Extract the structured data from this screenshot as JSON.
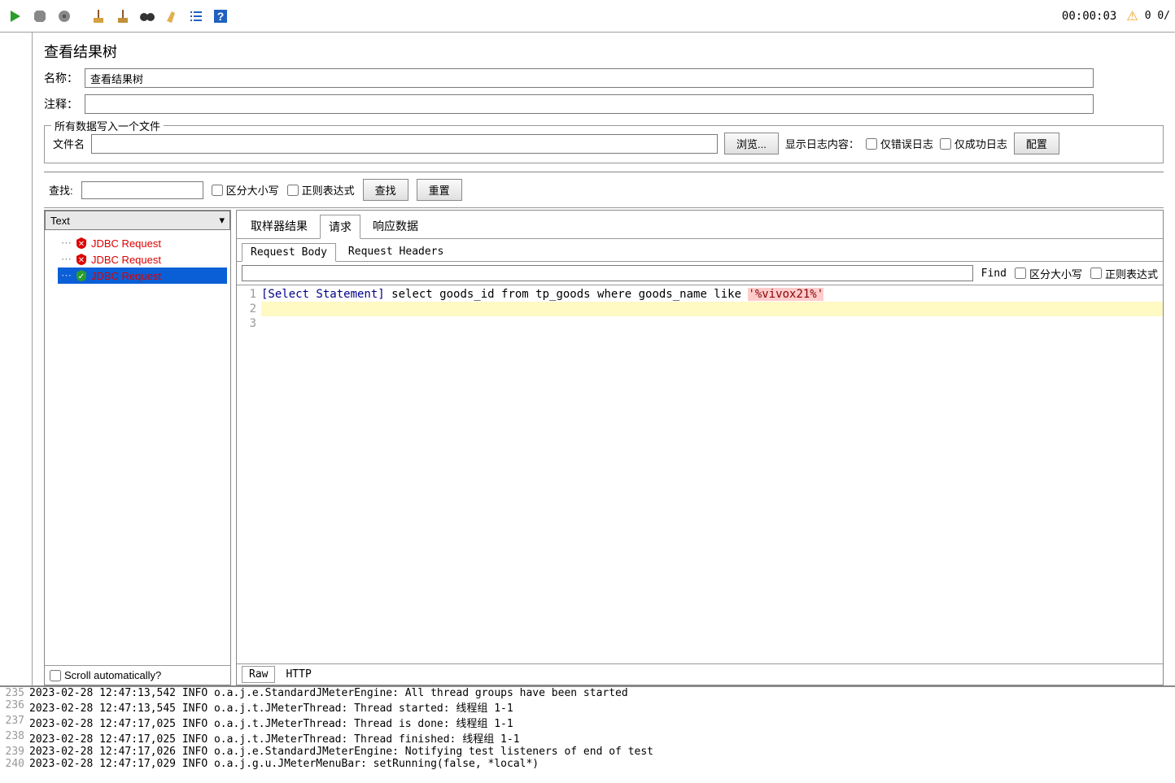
{
  "toolbar": {
    "timer": "00:00:03",
    "count": "0  0/"
  },
  "panel": {
    "title": "查看结果树",
    "name_label": "名称：",
    "name_value": "查看结果树",
    "comment_label": "注释：",
    "comment_value": ""
  },
  "file_section": {
    "legend": "所有数据写入一个文件",
    "filename_label": "文件名",
    "filename_value": "",
    "browse": "浏览...",
    "show_log_label": "显示日志内容：",
    "only_error": "仅错误日志",
    "only_success": "仅成功日志",
    "configure": "配置"
  },
  "search": {
    "label": "查找:",
    "value": "",
    "case_sensitive": "区分大小写",
    "regex": "正则表达式",
    "find_btn": "查找",
    "reset_btn": "重置"
  },
  "tree": {
    "combo_value": "Text",
    "items": [
      {
        "status": "fail",
        "label": "JDBC Request"
      },
      {
        "status": "fail",
        "label": "JDBC Request"
      },
      {
        "status": "ok",
        "label": "JDBC Request"
      }
    ],
    "scroll_auto": "Scroll automatically?"
  },
  "detail": {
    "tabs": [
      "取样器结果",
      "请求",
      "响应数据"
    ],
    "active_tab": 1,
    "subtabs": [
      "Request Body",
      "Request Headers"
    ],
    "active_subtab": 0,
    "find_label": "Find",
    "find_case": "区分大小写",
    "find_regex": "正则表达式",
    "code": {
      "line1_prefix": "[Select Statement] ",
      "line1_sql": "select goods_id from tp_goods where goods_name like ",
      "line1_str": "'%vivox21%'"
    },
    "bottom_tabs": [
      "Raw",
      "HTTP"
    ]
  },
  "log": [
    {
      "n": 235,
      "t": "2023-02-28 12:47:13,542 INFO o.a.j.e.StandardJMeterEngine: All thread groups have been started"
    },
    {
      "n": 236,
      "t": "2023-02-28 12:47:13,545 INFO o.a.j.t.JMeterThread: Thread started: 线程组 1-1"
    },
    {
      "n": 237,
      "t": "2023-02-28 12:47:17,025 INFO o.a.j.t.JMeterThread: Thread is done: 线程组 1-1"
    },
    {
      "n": 238,
      "t": "2023-02-28 12:47:17,025 INFO o.a.j.t.JMeterThread: Thread finished: 线程组 1-1"
    },
    {
      "n": 239,
      "t": "2023-02-28 12:47:17,026 INFO o.a.j.e.StandardJMeterEngine: Notifying test listeners of end of test"
    },
    {
      "n": 240,
      "t": "2023-02-28 12:47:17,029 INFO o.a.j.g.u.JMeterMenuBar: setRunning(false, *local*)"
    }
  ]
}
